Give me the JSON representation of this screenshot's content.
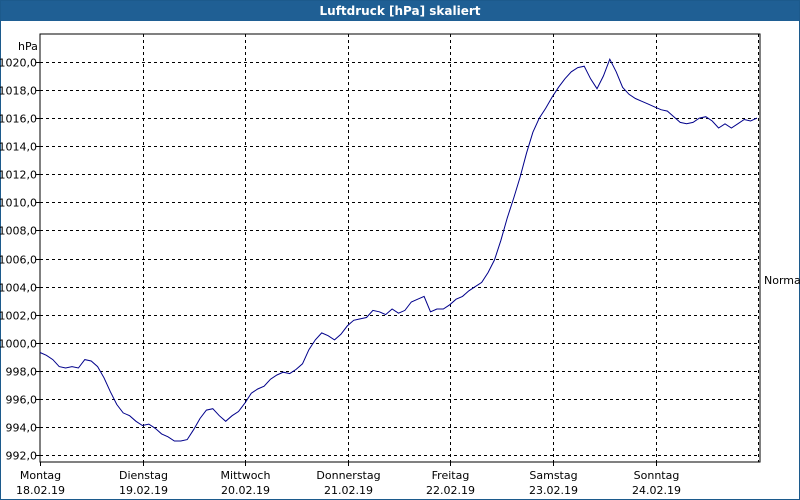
{
  "window": {
    "title": "Luftdruck [hPa] skaliert"
  },
  "chart_data": {
    "type": "line",
    "title": "Luftdruck [hPa] skaliert",
    "ylabel": "hPa",
    "xlabel": "",
    "ylim": [
      992,
      1020
    ],
    "yticks": [
      "1020,0",
      "1018,0",
      "1016,0",
      "1014,0",
      "1012,0",
      "1010,0",
      "1008,0",
      "1006,0",
      "1004,0",
      "1002,0",
      "1000,0",
      "998,0",
      "996,0",
      "994,0",
      "992,0"
    ],
    "xticks": [
      {
        "day": "Montag",
        "date": "18.02.19"
      },
      {
        "day": "Dienstag",
        "date": "19.02.19"
      },
      {
        "day": "Mittwoch",
        "date": "20.02.19"
      },
      {
        "day": "Donnerstag",
        "date": "21.02.19"
      },
      {
        "day": "Freitag",
        "date": "22.02.19"
      },
      {
        "day": "Samstag",
        "date": "23.02.19"
      },
      {
        "day": "Sonntag",
        "date": "24.02.19"
      }
    ],
    "reference_label": "Normal",
    "grid": true,
    "line_color": "#00008b",
    "series": [
      {
        "values": [
          999.3,
          999.1,
          998.8,
          998.3,
          998.2,
          998.3,
          998.2,
          998.8,
          998.7,
          998.3,
          997.5,
          996.5,
          995.6,
          995.0,
          994.8,
          994.4,
          994.1,
          994.2,
          993.9,
          993.5,
          993.3,
          993.0,
          993.0,
          993.1,
          993.8,
          994.6,
          995.2,
          995.3,
          994.8,
          994.4,
          994.8,
          995.1,
          995.7,
          996.4,
          996.7,
          996.9,
          997.4,
          997.7,
          997.9,
          997.8,
          998.1,
          998.5,
          999.5,
          1000.2,
          1000.7,
          1000.5,
          1000.2,
          1000.6,
          1001.2,
          1001.6,
          1001.7,
          1001.8,
          1002.3,
          1002.2,
          1002.0,
          1002.4,
          1002.1,
          1002.3,
          1002.9,
          1003.1,
          1003.3,
          1002.2,
          1002.4,
          1002.4,
          1002.7,
          1003.1,
          1003.3,
          1003.7,
          1004.0,
          1004.3,
          1005.0,
          1005.9,
          1007.3,
          1008.9,
          1010.3,
          1011.8,
          1013.5,
          1015.0,
          1016.0,
          1016.7,
          1017.5,
          1018.2,
          1018.8,
          1019.3,
          1019.6,
          1019.7,
          1018.8,
          1018.1,
          1019.0,
          1020.2,
          1019.3,
          1018.2,
          1017.7,
          1017.4,
          1017.2,
          1017.0,
          1016.8,
          1016.6,
          1016.5,
          1016.1,
          1015.7,
          1015.6,
          1015.7,
          1016.0,
          1016.1,
          1015.8,
          1015.3,
          1015.6,
          1015.3,
          1015.6,
          1015.9,
          1015.8,
          1016.0
        ]
      }
    ]
  }
}
